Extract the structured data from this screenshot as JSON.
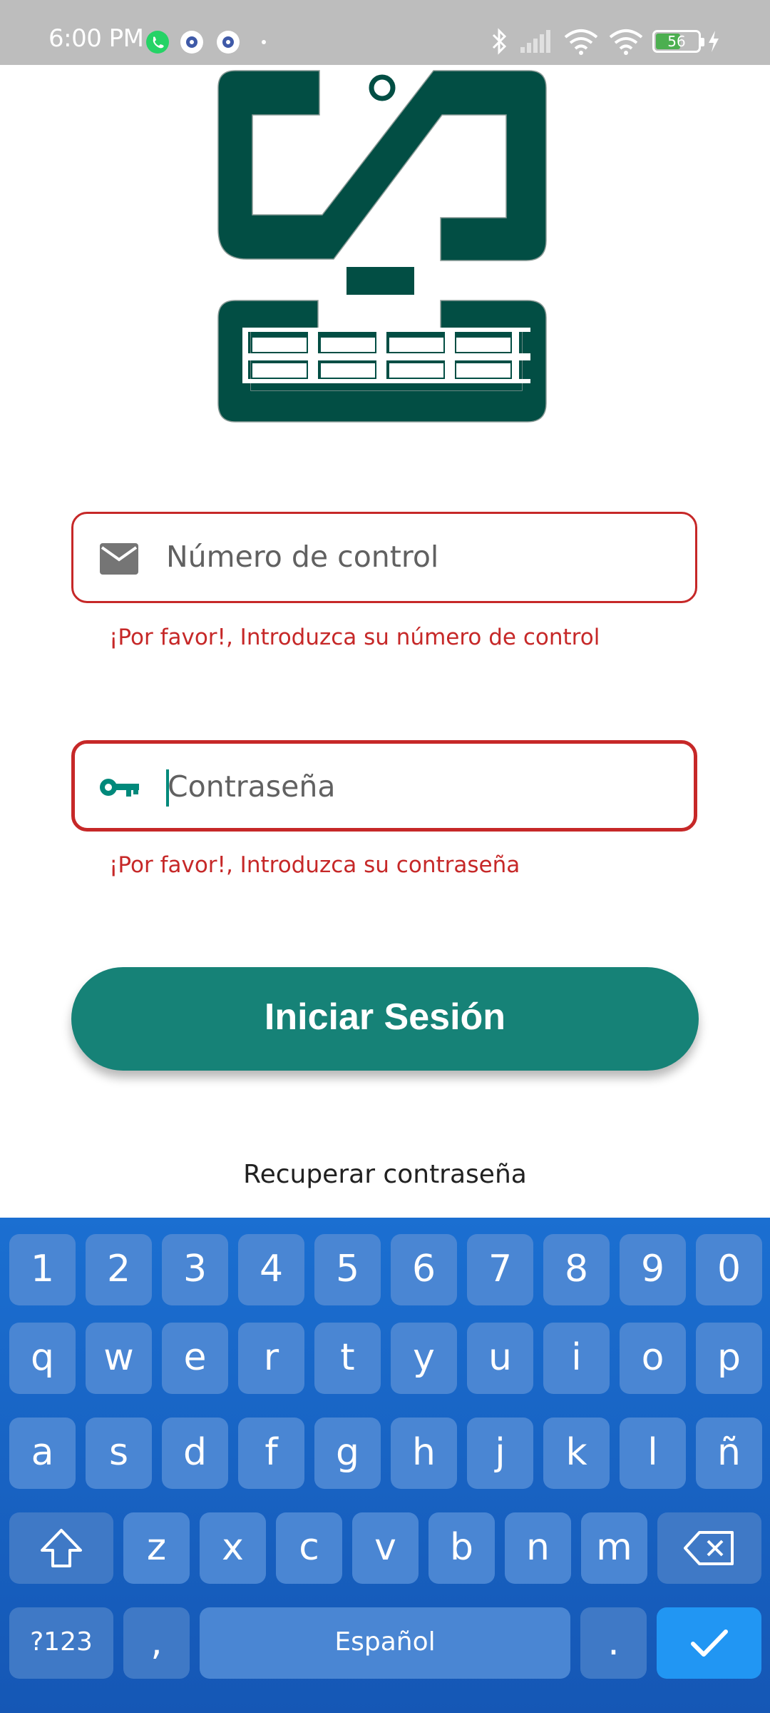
{
  "status_bar": {
    "time": "6:00 PM",
    "notification_icons": [
      "whatsapp-icon",
      "settings-app-icon",
      "settings-app-icon"
    ],
    "system_icons": [
      "bluetooth-icon",
      "signal-icon",
      "wifi-icon",
      "wifi-icon"
    ],
    "battery_level": "56",
    "charging": true
  },
  "form": {
    "control_number": {
      "placeholder": "Número de control",
      "error": "¡Por favor!, Introduzca su número de control",
      "icon": "mail-icon"
    },
    "password": {
      "placeholder": "Contraseña",
      "error": "¡Por favor!, Introduzca su contraseña",
      "icon": "key-icon"
    },
    "login_label": "Iniciar Sesión",
    "recover_label": "Recuperar contraseña"
  },
  "colors": {
    "accent": "#168277",
    "error": "#c62828",
    "logo": "#024e44",
    "keyboard": "#1b6fd1"
  },
  "keyboard": {
    "row_numbers": [
      "1",
      "2",
      "3",
      "4",
      "5",
      "6",
      "7",
      "8",
      "9",
      "0"
    ],
    "row_1": [
      "q",
      "w",
      "e",
      "r",
      "t",
      "y",
      "u",
      "i",
      "o",
      "p"
    ],
    "row_2": [
      "a",
      "s",
      "d",
      "f",
      "g",
      "h",
      "j",
      "k",
      "l",
      "ñ"
    ],
    "row_3": [
      "z",
      "x",
      "c",
      "v",
      "b",
      "n",
      "m"
    ],
    "symbols_label": "?123",
    "comma_label": ",",
    "space_label": "Español",
    "period_label": "."
  }
}
